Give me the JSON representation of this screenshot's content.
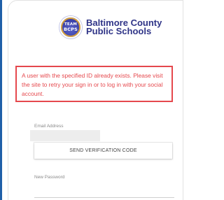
{
  "logo": {
    "badge_line1": "TEAM",
    "badge_line2": "BCPS",
    "name_line1": "Baltimore County",
    "name_line2": "Public Schools",
    "brand_color": "#2f3487"
  },
  "error": {
    "message": "A user with the specified ID already exists. Please visit the site to retry your sign in or to log in with your social account.",
    "color": "#e5484d"
  },
  "form": {
    "email_label": "Email Address",
    "email_value": "",
    "send_button_label": "SEND VERIFICATION CODE",
    "password_label": "New Password"
  }
}
